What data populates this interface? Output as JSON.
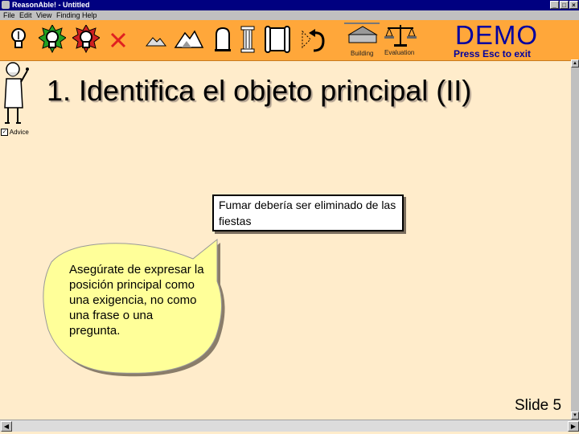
{
  "window": {
    "title": "ReasonAble! - Untitled",
    "min": "_",
    "max": "□",
    "close": "×"
  },
  "menu": [
    "File",
    "Edit",
    "View",
    "Finding",
    "Help"
  ],
  "toolbar": {
    "tools": [
      {
        "icon": "lightbulb-icon"
      },
      {
        "icon": "lightbulb-green-icon"
      },
      {
        "icon": "lightbulb-red-icon"
      },
      {
        "icon": "delete-x-icon"
      },
      {
        "icon": "mountain-icon"
      },
      {
        "icon": "mountains-icon"
      },
      {
        "icon": "tombstone-icon"
      },
      {
        "icon": "pillar-icon"
      },
      {
        "icon": "scroll-icon"
      },
      {
        "icon": "undo-arrow-icon"
      },
      {
        "icon": "building-icon"
      },
      {
        "icon": "scales-icon"
      }
    ],
    "building_label": "Building",
    "evaluation_label": "Evaluation",
    "demo": "DEMO",
    "demo_hint": "Press Esc to exit"
  },
  "slide": {
    "title": "1. Identifica el objeto principal (II)",
    "advice_label": "Advice",
    "advice_checked": "✓",
    "claim": "Fumar debería ser eliminado de las fiestas",
    "bubble": "Asegúrate de expresar la posición principal como una exigencia, no como una frase o una pregunta.",
    "slide_number": "Slide 5"
  },
  "colors": {
    "background": "#ffeccb",
    "toolbar": "#ffa73a",
    "bubble": "#ffff99",
    "demo": "#0000a0",
    "titlebar": "#000080"
  }
}
